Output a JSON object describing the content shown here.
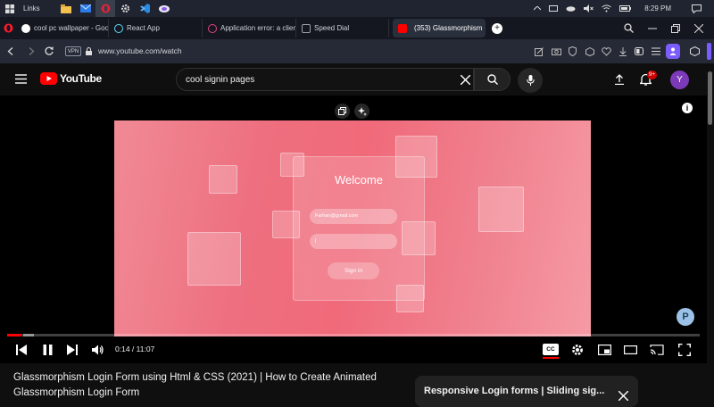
{
  "taskbar": {
    "links_label": "Links",
    "time": "8:29 PM"
  },
  "browser": {
    "tabs": [
      {
        "label": "cool pc wallpaper - Goog",
        "favicon_color": "#4285f4"
      },
      {
        "label": "React App",
        "favicon_color": "#61dafb"
      },
      {
        "label": "Application error: a client",
        "favicon_color": "#e0457b"
      },
      {
        "label": "Speed Dial",
        "favicon_color": "#9aa0ac"
      },
      {
        "label": "(353) Glassmorphism",
        "favicon_color": "#ff0000",
        "active": true
      }
    ],
    "vpn_label": "VPN",
    "url": "www.youtube.com/watch",
    "accent": "#7b5cff"
  },
  "youtube": {
    "logo_text": "YouTube",
    "search_value": "cool signin pages",
    "notification_badge": "9+",
    "avatar_letter": "Y"
  },
  "video_content": {
    "welcome": "Welcome",
    "email_value": "Farhan@gmail.com",
    "password_value": "|",
    "signin_label": "Sign in",
    "background_colors": [
      "#f08a95",
      "#ee6f7f",
      "#f59aa3"
    ]
  },
  "player": {
    "current_time": "0:14",
    "duration": "11:07",
    "time_display": "0:14 / 11:07",
    "progress_fraction": 0.021,
    "cc_label": "CC"
  },
  "video": {
    "title": "Glassmorphism Login Form using Html & CSS (2021) | How to Create Animated Glassmorphism Login Form"
  },
  "miniplayer": {
    "title": "Responsive Login forms | Sliding sig..."
  }
}
